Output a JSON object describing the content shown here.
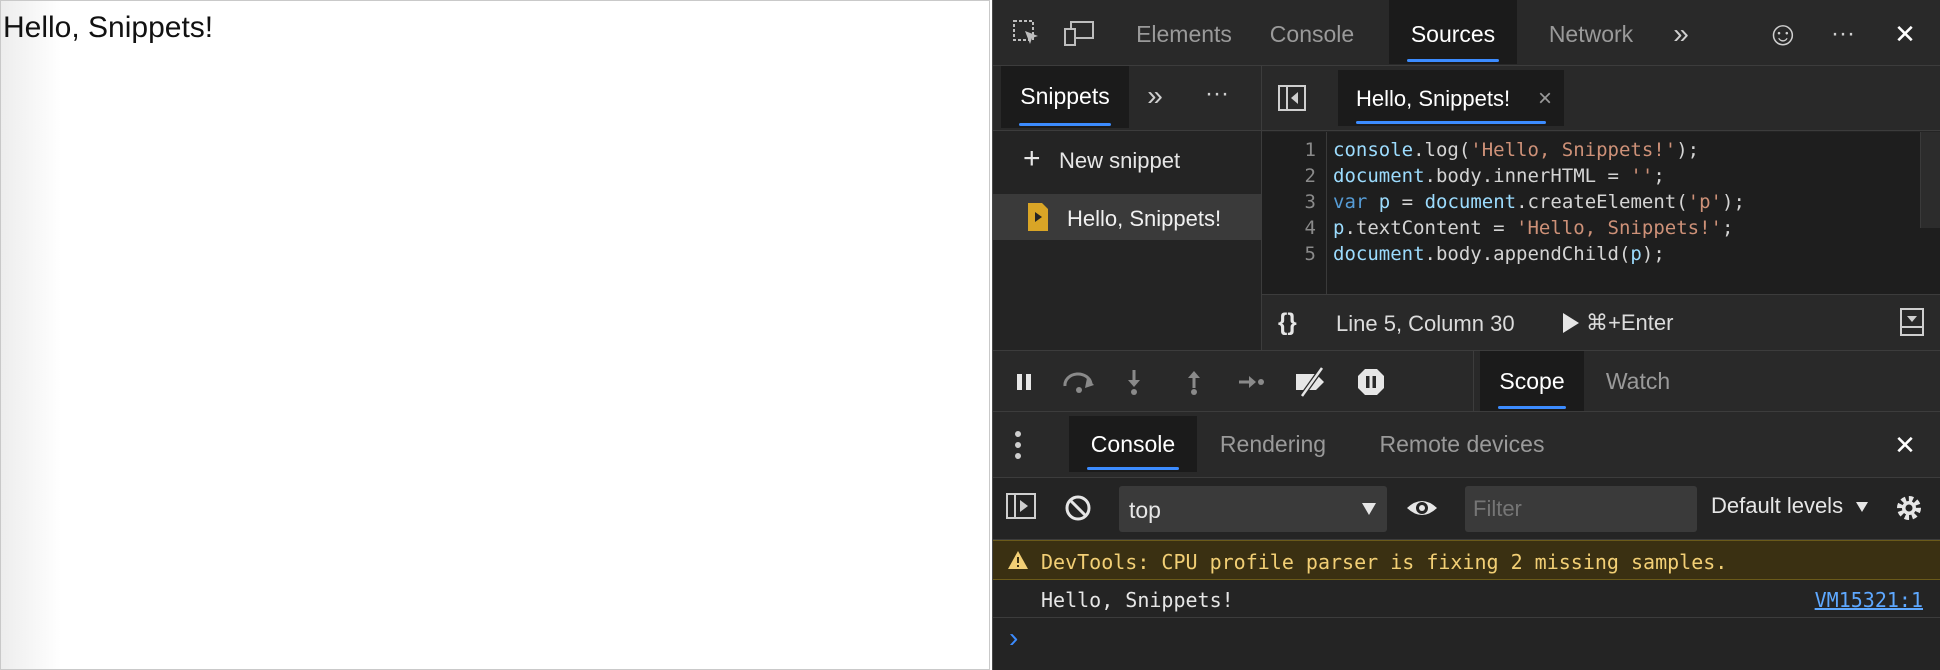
{
  "page": {
    "text": "Hello, Snippets!"
  },
  "toolbar": {
    "tabs": [
      {
        "label": "Elements",
        "active": false
      },
      {
        "label": "Console",
        "active": false
      },
      {
        "label": "Sources",
        "active": true
      },
      {
        "label": "Network",
        "active": false
      }
    ],
    "more_symbol": "»",
    "feedback_symbol": "☺",
    "menu_symbol": "···",
    "close_symbol": "✕"
  },
  "navigator": {
    "tab_label": "Snippets",
    "more_symbol": "»",
    "menu_symbol": "···",
    "new_snippet_icon": "+",
    "new_snippet_label": "New snippet",
    "items": [
      {
        "label": "Hello, Snippets!",
        "selected": true
      }
    ]
  },
  "editor": {
    "tab_label": "Hello, Snippets!",
    "tab_close": "×",
    "line_numbers": [
      "1",
      "2",
      "3",
      "4",
      "5"
    ],
    "line_4_num": "5"
  },
  "status": {
    "format_symbol": "{}",
    "position": "Line 5, Column 30",
    "run_label": "⌘+Enter"
  },
  "debugger": {
    "tabs": [
      {
        "label": "Scope",
        "active": true
      },
      {
        "label": "Watch",
        "active": false
      }
    ]
  },
  "drawer": {
    "tabs": [
      {
        "label": "Console",
        "active": true
      },
      {
        "label": "Rendering",
        "active": false
      },
      {
        "label": "Remote devices",
        "active": false
      }
    ],
    "close_symbol": "✕"
  },
  "console_toolbar": {
    "context_value": "top",
    "filter_placeholder": "Filter",
    "levels_label": "Default levels"
  },
  "console": {
    "warning_text": "DevTools: CPU profile parser is fixing 2 missing samples.",
    "log_text": "Hello, Snippets!",
    "log_source": "VM15321:1",
    "prompt_symbol": "›"
  },
  "colors": {
    "accent": "#3c8cff",
    "warning": "#f2cf75",
    "link": "#5ea8ff",
    "snippet_icon": "#d9a526"
  }
}
